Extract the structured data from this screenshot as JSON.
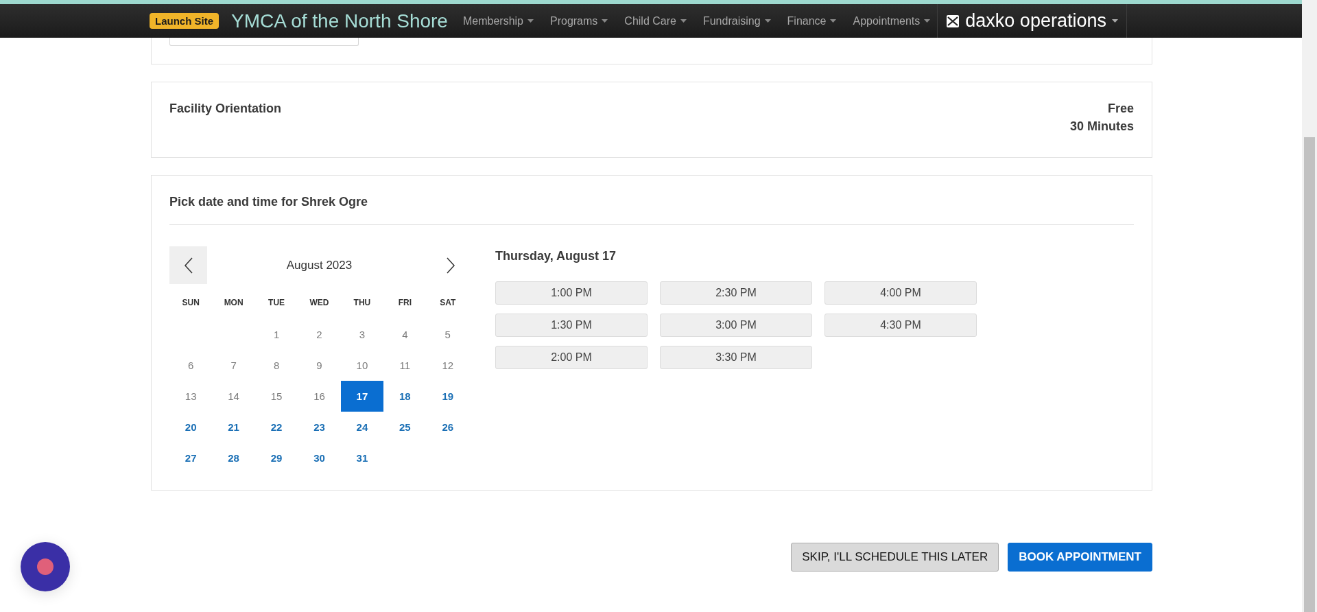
{
  "topbar": {
    "badge": "Launch Site",
    "site_title": "YMCA of the North Shore",
    "menu": [
      {
        "label": "Membership"
      },
      {
        "label": "Programs"
      },
      {
        "label": "Child Care"
      },
      {
        "label": "Fundraising"
      },
      {
        "label": "Finance"
      },
      {
        "label": "Appointments"
      }
    ],
    "product": "daxko operations"
  },
  "service": {
    "name": "Facility Orientation",
    "price": "Free",
    "duration": "30 Minutes"
  },
  "scheduler": {
    "title": "Pick date and time for Shrek Ogre",
    "month": "August 2023",
    "weekdays": [
      "SUN",
      "MON",
      "TUE",
      "WED",
      "THU",
      "FRI",
      "SAT"
    ],
    "weeks": [
      [
        {
          "kind": "empty"
        },
        {
          "kind": "empty"
        },
        {
          "kind": "day",
          "label": "1",
          "available": false,
          "selected": false
        },
        {
          "kind": "day",
          "label": "2",
          "available": false,
          "selected": false
        },
        {
          "kind": "day",
          "label": "3",
          "available": false,
          "selected": false
        },
        {
          "kind": "day",
          "label": "4",
          "available": false,
          "selected": false
        },
        {
          "kind": "day",
          "label": "5",
          "available": false,
          "selected": false
        }
      ],
      [
        {
          "kind": "day",
          "label": "6",
          "available": false,
          "selected": false
        },
        {
          "kind": "day",
          "label": "7",
          "available": false,
          "selected": false
        },
        {
          "kind": "day",
          "label": "8",
          "available": false,
          "selected": false
        },
        {
          "kind": "day",
          "label": "9",
          "available": false,
          "selected": false
        },
        {
          "kind": "day",
          "label": "10",
          "available": false,
          "selected": false
        },
        {
          "kind": "day",
          "label": "11",
          "available": false,
          "selected": false
        },
        {
          "kind": "day",
          "label": "12",
          "available": false,
          "selected": false
        }
      ],
      [
        {
          "kind": "day",
          "label": "13",
          "available": false,
          "selected": false
        },
        {
          "kind": "day",
          "label": "14",
          "available": false,
          "selected": false
        },
        {
          "kind": "day",
          "label": "15",
          "available": false,
          "selected": false
        },
        {
          "kind": "day",
          "label": "16",
          "available": false,
          "selected": false
        },
        {
          "kind": "day",
          "label": "17",
          "available": true,
          "selected": true
        },
        {
          "kind": "day",
          "label": "18",
          "available": true,
          "selected": false
        },
        {
          "kind": "day",
          "label": "19",
          "available": true,
          "selected": false
        }
      ],
      [
        {
          "kind": "day",
          "label": "20",
          "available": true,
          "selected": false
        },
        {
          "kind": "day",
          "label": "21",
          "available": true,
          "selected": false
        },
        {
          "kind": "day",
          "label": "22",
          "available": true,
          "selected": false
        },
        {
          "kind": "day",
          "label": "23",
          "available": true,
          "selected": false
        },
        {
          "kind": "day",
          "label": "24",
          "available": true,
          "selected": false
        },
        {
          "kind": "day",
          "label": "25",
          "available": true,
          "selected": false
        },
        {
          "kind": "day",
          "label": "26",
          "available": true,
          "selected": false
        }
      ],
      [
        {
          "kind": "day",
          "label": "27",
          "available": true,
          "selected": false
        },
        {
          "kind": "day",
          "label": "28",
          "available": true,
          "selected": false
        },
        {
          "kind": "day",
          "label": "29",
          "available": true,
          "selected": false
        },
        {
          "kind": "day",
          "label": "30",
          "available": true,
          "selected": false
        },
        {
          "kind": "day",
          "label": "31",
          "available": true,
          "selected": false
        },
        {
          "kind": "empty"
        },
        {
          "kind": "empty"
        }
      ]
    ],
    "selected_date": "Thursday, August 17",
    "times": [
      "1:00 PM",
      "1:30 PM",
      "2:00 PM",
      "2:30 PM",
      "3:00 PM",
      "3:30 PM",
      "4:00 PM",
      "4:30 PM"
    ]
  },
  "actions": {
    "skip": "SKIP, I'LL SCHEDULE THIS LATER",
    "book": "BOOK APPOINTMENT"
  }
}
